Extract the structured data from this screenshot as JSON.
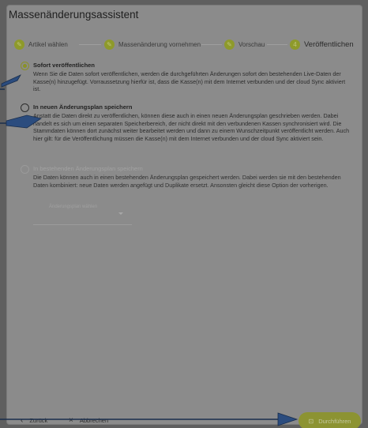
{
  "dialog": {
    "title": "Massenänderungsassistent"
  },
  "stepper": {
    "steps": [
      {
        "label": "Artikel wählen",
        "icon": "pencil-icon"
      },
      {
        "label": "Massenänderung vornehmen",
        "icon": "pencil-icon"
      },
      {
        "label": "Vorschau",
        "icon": "pencil-icon"
      },
      {
        "label": "Veröffentlichen",
        "number": "4"
      }
    ],
    "active_index": 3
  },
  "options": [
    {
      "title": "Sofort veröffentlichen",
      "selected": true,
      "disabled": false,
      "description": "Wenn Sie die Daten sofort veröffentlichen, werden die durchgeführten Änderungen sofort den bestehenden Live-Daten der Kasse(n) hinzugefügt. Vorraussetzung hierfür ist, dass die Kasse(n) mit dem Internet verbunden und der cloud Sync aktiviert ist."
    },
    {
      "title": "In neuen Änderungsplan speichern",
      "selected": false,
      "disabled": false,
      "description": "Anstatt die Daten direkt zu veröffentlichen, können diese auch in einen neuen Änderungsplan geschrieben werden. Dabei handelt es sich um einen separaten Speicherbereich, der nicht direkt mit den verbundenen Kassen synchronisiert wird. Die Stammdaten können dort zunächst weiter bearbeitet werden und dann zu einem Wunschzeitpunkt veröffentlicht werden. Auch hier gilt: für die Veröffentlichung müssen die Kasse(n) mit dem Internet verbunden und der cloud Sync aktiviert sein."
    },
    {
      "title": "In bestehenden Änderungsplan speichern",
      "selected": false,
      "disabled": true,
      "description": "Die Daten können auch in einen bestehenden Änderungsplan gespeichert werden. Dabei werden sie mit den bestehenden Daten kombiniert: neue Daten werden angefügt und Duplikate ersetzt. Ansonsten gleicht diese Option der vorherigen."
    }
  ],
  "plan_select": {
    "placeholder": "Änderungsplan wählen"
  },
  "footer": {
    "back_label": "Zurück",
    "cancel_label": "Abbrechen",
    "run_label": "Durchführen"
  },
  "colors": {
    "accent": "#8c9332",
    "overlay": "#8b8b8b",
    "annotation_arrow": "#2b4c7e"
  }
}
